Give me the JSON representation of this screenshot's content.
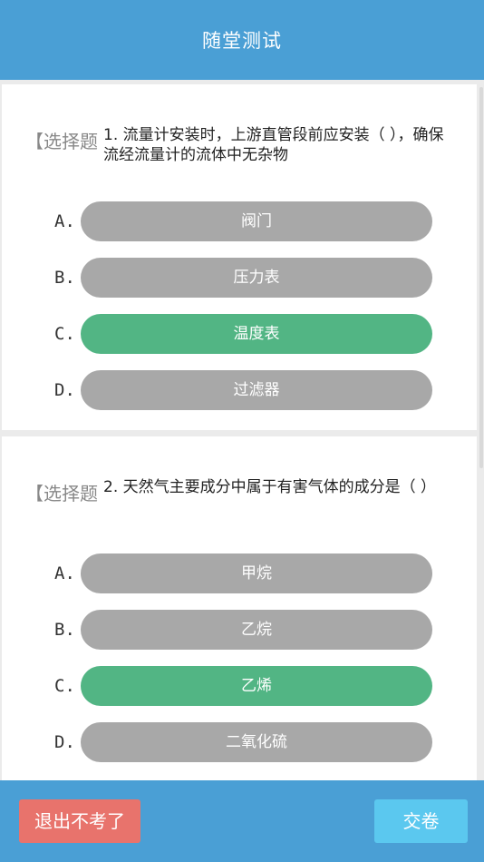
{
  "header": {
    "title": "随堂测试"
  },
  "questions": [
    {
      "tag": "【选择题",
      "text": "1. 流量计安装时，上游直管段前应安装（ ），确保流经流量计的流体中无杂物",
      "options": [
        {
          "letter": "A.",
          "label": "阀门",
          "selected": false
        },
        {
          "letter": "B.",
          "label": "压力表",
          "selected": false
        },
        {
          "letter": "C.",
          "label": "温度表",
          "selected": true
        },
        {
          "letter": "D.",
          "label": "过滤器",
          "selected": false
        }
      ]
    },
    {
      "tag": "【选择题",
      "text": "2. 天然气主要成分中属于有害气体的成分是（ ）",
      "options": [
        {
          "letter": "A.",
          "label": "甲烷",
          "selected": false
        },
        {
          "letter": "B.",
          "label": "乙烷",
          "selected": false
        },
        {
          "letter": "C.",
          "label": "乙烯",
          "selected": true
        },
        {
          "letter": "D.",
          "label": "二氧化硫",
          "selected": false
        }
      ]
    }
  ],
  "footer": {
    "exit_label": "退出不考了",
    "submit_label": "交卷"
  },
  "colors": {
    "header_bg": "#4a9fd5",
    "option_default": "#a8a8a8",
    "option_selected": "#52b584",
    "exit_button": "#e8736c",
    "submit_button": "#5bc8ef"
  }
}
